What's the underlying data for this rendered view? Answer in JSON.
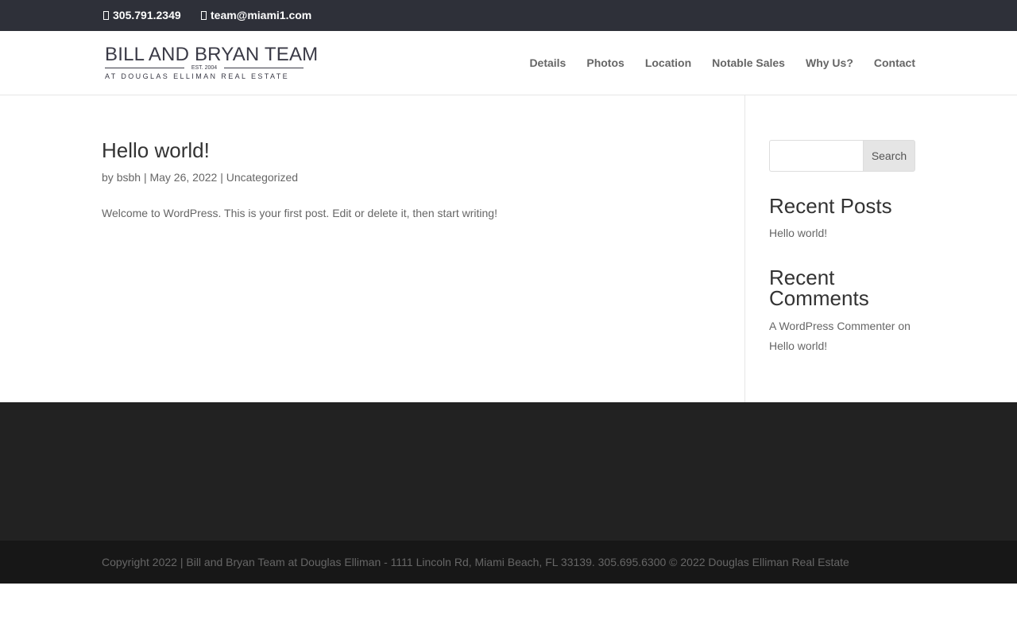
{
  "topbar": {
    "phone": "305.791.2349",
    "email": "team@miami1.com",
    "phone_icon": "phone-icon",
    "email_icon": "envelope-icon"
  },
  "logo": {
    "line1": "BILL AND BRYAN TEAM",
    "est": "EST. 2004",
    "line2": "AT DOUGLAS ELLIMAN REAL ESTATE"
  },
  "nav": {
    "items": [
      "Details",
      "Photos",
      "Location",
      "Notable Sales",
      "Why Us?",
      "Contact"
    ]
  },
  "post": {
    "title": "Hello world!",
    "meta_by": "by",
    "author": "bsbh",
    "sep1": "|",
    "date": "May 26, 2022",
    "sep2": "|",
    "category": "Uncategorized",
    "body": "Welcome to WordPress. This is your first post. Edit or delete it, then start writing!"
  },
  "sidebar": {
    "search_placeholder": "",
    "search_button": "Search",
    "recent_posts_title": "Recent Posts",
    "recent_posts": [
      "Hello world!"
    ],
    "recent_comments_title": "Recent Comments",
    "comment_author": "A WordPress Commenter",
    "comment_on": "on",
    "comment_post": "Hello world!"
  },
  "footer": {
    "copyright": "Copyright 2022 | Bill and Bryan Team at Douglas Elliman - 1111 Lincoln Rd, Miami Beach, FL 33139. 305.695.6300 © 2022 Douglas Elliman Real Estate"
  },
  "colors": {
    "topbar_bg": "#2e3039",
    "footer_bg": "#222222",
    "bottom_bar_bg": "#171717",
    "text": "#666666",
    "heading": "#333333"
  }
}
